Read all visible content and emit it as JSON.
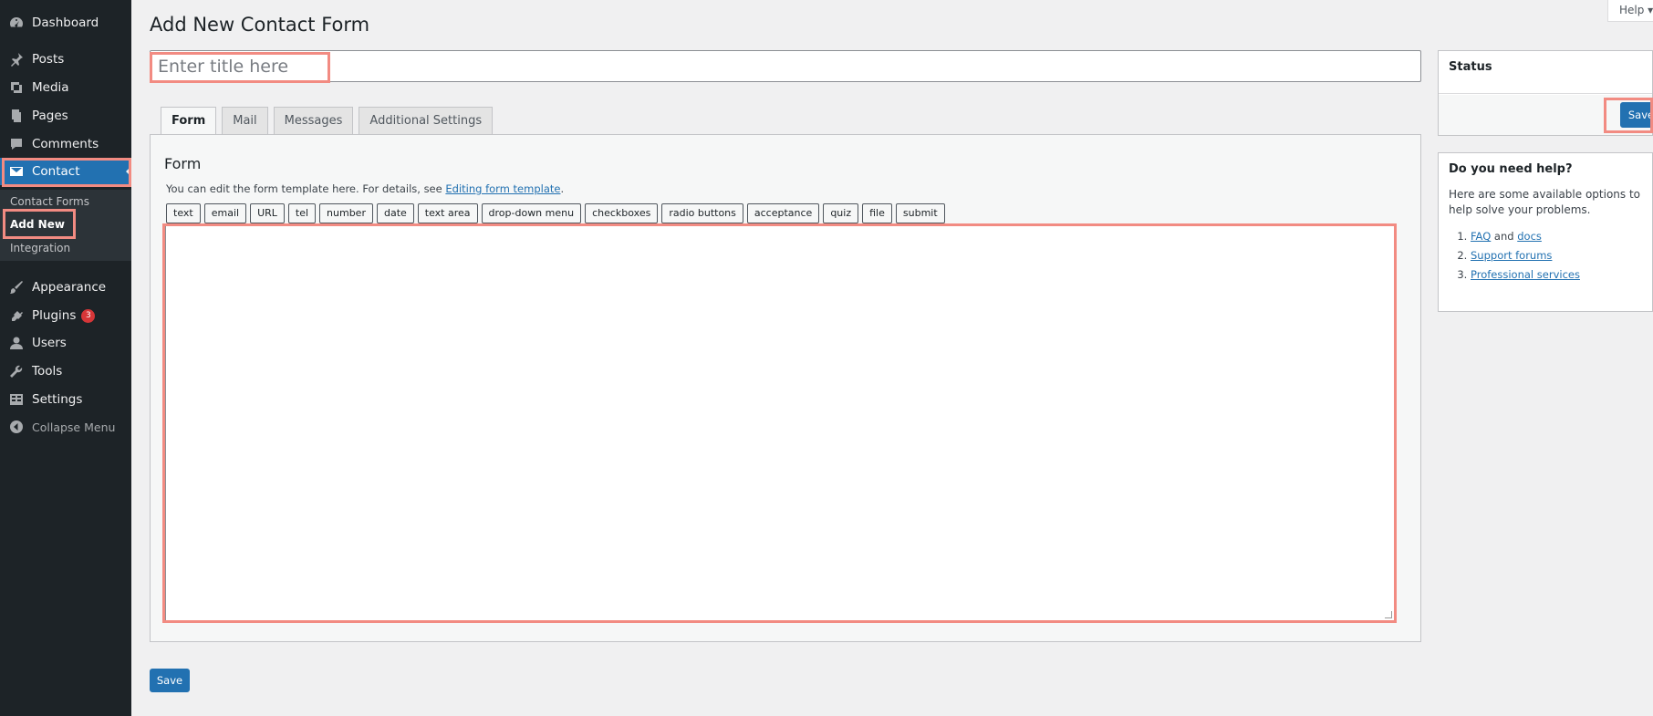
{
  "sidebar": {
    "items": [
      {
        "label": "Dashboard",
        "icon": "dashboard-icon"
      },
      {
        "label": "Posts",
        "icon": "pin-icon"
      },
      {
        "label": "Media",
        "icon": "media-icon"
      },
      {
        "label": "Pages",
        "icon": "pages-icon"
      },
      {
        "label": "Comments",
        "icon": "comment-icon"
      },
      {
        "label": "Contact",
        "icon": "mail-icon"
      },
      {
        "label": "Appearance",
        "icon": "brush-icon"
      },
      {
        "label": "Plugins",
        "icon": "plug-icon",
        "badge": "3"
      },
      {
        "label": "Users",
        "icon": "user-icon"
      },
      {
        "label": "Tools",
        "icon": "wrench-icon"
      },
      {
        "label": "Settings",
        "icon": "settings-icon"
      }
    ],
    "submenu": [
      "Contact Forms",
      "Add New",
      "Integration"
    ],
    "collapse_label": "Collapse Menu"
  },
  "page": {
    "title": "Add New Contact Form",
    "help_label": "Help ▾",
    "title_placeholder": "Enter title here"
  },
  "tabs": [
    "Form",
    "Mail",
    "Messages",
    "Additional Settings"
  ],
  "form": {
    "heading": "Form",
    "description_prefix": "You can edit the form template here. For details, see ",
    "description_link": "Editing form template",
    "description_suffix": ".",
    "tag_buttons": [
      "text",
      "email",
      "URL",
      "tel",
      "number",
      "date",
      "text area",
      "drop-down menu",
      "checkboxes",
      "radio buttons",
      "acceptance",
      "quiz",
      "file",
      "submit"
    ]
  },
  "status": {
    "heading": "Status",
    "save_label": "Save"
  },
  "help_box": {
    "heading": "Do you need help?",
    "intro": "Here are some available options to help solve your problems.",
    "faq": "FAQ",
    "and": " and ",
    "docs": "docs",
    "support": "Support forums",
    "professional": "Professional services"
  },
  "bottom_save_label": "Save",
  "colors": {
    "accent": "#2271b1",
    "sidebar_bg": "#1d2327",
    "highlight": "#f28b82",
    "badge": "#d63638"
  }
}
